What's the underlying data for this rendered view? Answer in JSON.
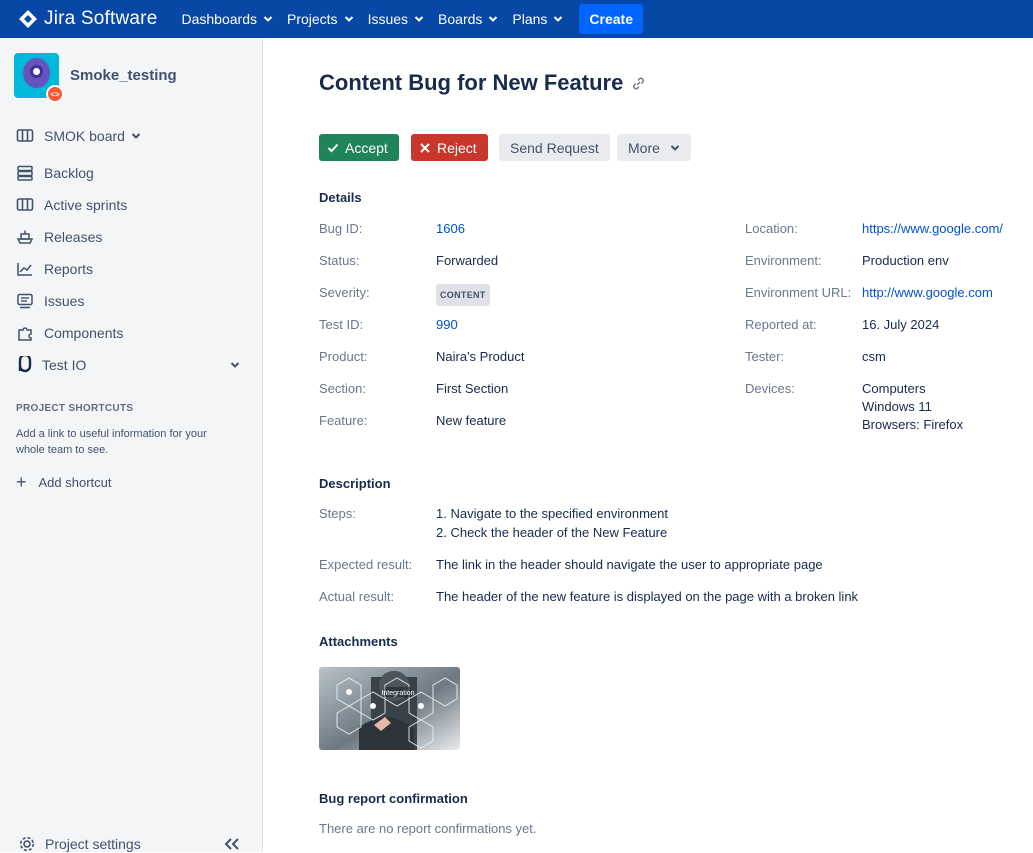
{
  "topnav": {
    "brand": "Jira Software",
    "items": [
      {
        "label": "Dashboards"
      },
      {
        "label": "Projects"
      },
      {
        "label": "Issues"
      },
      {
        "label": "Boards"
      },
      {
        "label": "Plans"
      }
    ],
    "create_label": "Create",
    "colors": {
      "bar": "#0747a6",
      "create": "#0065ff"
    }
  },
  "sidebar": {
    "project_name": "Smoke_testing",
    "board": {
      "label": "SMOK board",
      "icon": "board-icon"
    },
    "items": [
      {
        "label": "Backlog",
        "icon": "backlog-icon"
      },
      {
        "label": "Active sprints",
        "icon": "sprints-icon"
      },
      {
        "label": "Releases",
        "icon": "ship-icon"
      },
      {
        "label": "Reports",
        "icon": "chart-icon"
      },
      {
        "label": "Issues",
        "icon": "issues-icon"
      },
      {
        "label": "Components",
        "icon": "puzzle-icon"
      }
    ],
    "test_io": {
      "label": "Test IO",
      "icon": "testio-icon"
    },
    "shortcuts_title": "PROJECT SHORTCUTS",
    "shortcuts_help": "Add a link to useful information for your whole team to see.",
    "add_shortcut": "Add shortcut",
    "project_settings": "Project settings"
  },
  "issue": {
    "title": "Content Bug for New Feature",
    "actions": {
      "accept": "Accept",
      "reject": "Reject",
      "send_request": "Send Request",
      "more": "More"
    },
    "details_title": "Details",
    "details_left": [
      {
        "label": "Bug ID:",
        "value": "1606"
      },
      {
        "label": "Status:",
        "value": "Forwarded"
      },
      {
        "label": "Severity:",
        "value": "CONTENT"
      },
      {
        "label": "Test ID:",
        "value": "990"
      },
      {
        "label": "Product:",
        "value": "Naira's Product"
      },
      {
        "label": "Section:",
        "value": "First Section"
      },
      {
        "label": "Feature:",
        "value": "New feature"
      }
    ],
    "details_right": [
      {
        "label": "Location:",
        "value": "https://www.google.com/"
      },
      {
        "label": "Environment:",
        "value": "Production env"
      },
      {
        "label": "Environment URL:",
        "value": "http://www.google.com"
      },
      {
        "label": "Reported at:",
        "value": "16. July 2024"
      },
      {
        "label": "Tester:",
        "value": "csm"
      },
      {
        "label": "Devices:",
        "lines": [
          "Computers",
          "Windows 11",
          "Browsers: Firefox"
        ]
      }
    ],
    "description_title": "Description",
    "steps_label": "Steps:",
    "steps": [
      "1. Navigate to the specified environment",
      "2. Check the header of the New Feature"
    ],
    "expected_label": "Expected result:",
    "expected": "The link in the header should navigate the user to appropriate page",
    "actual_label": "Actual result:",
    "actual": "The header of the new feature is displayed on the page with a broken link",
    "attachments_title": "Attachments",
    "attachment_caption": "Integration",
    "confirmation_title": "Bug report confirmation",
    "confirmation_text": "There are no report confirmations yet."
  }
}
